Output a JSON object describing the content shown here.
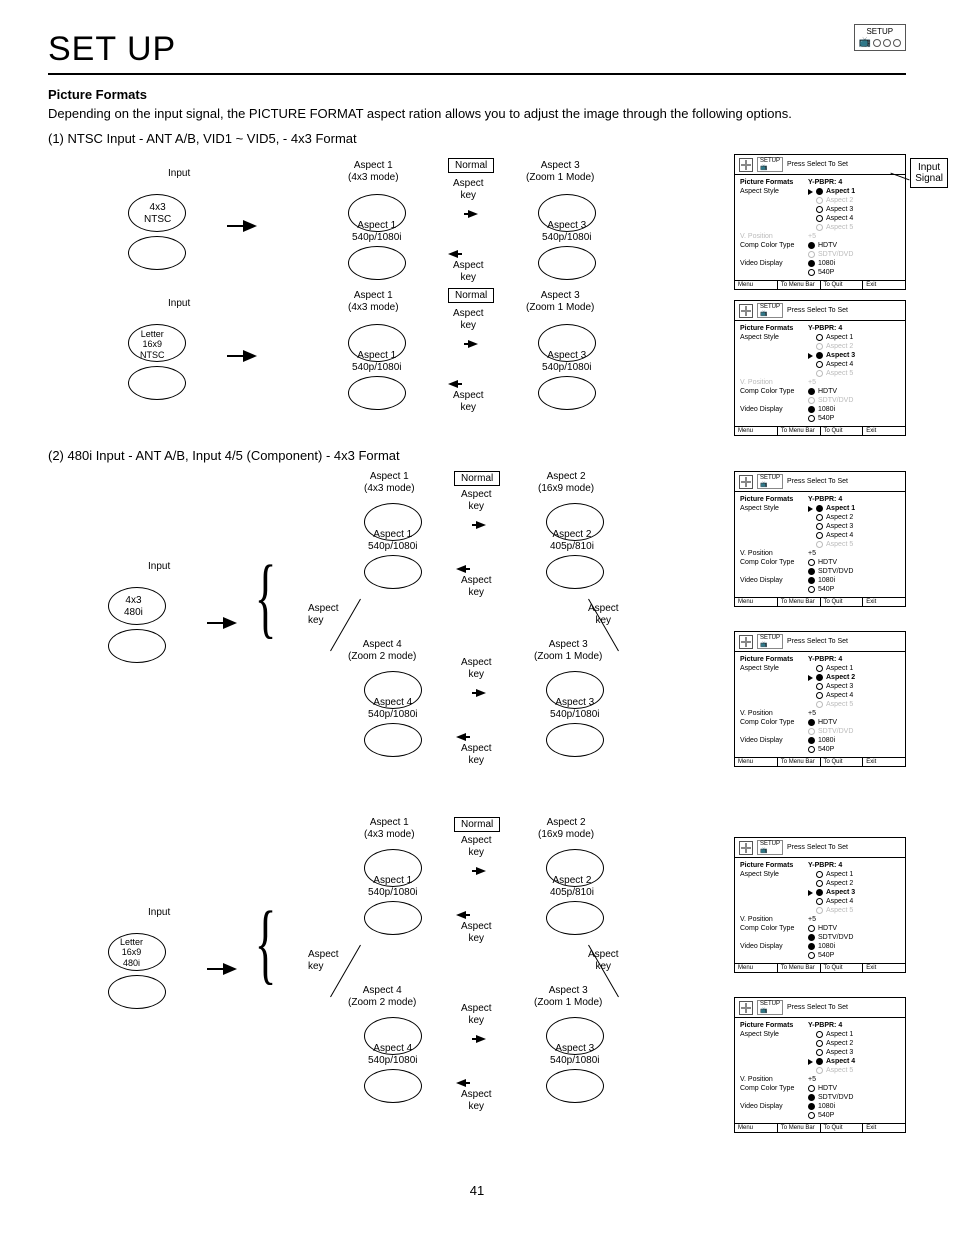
{
  "header": {
    "title": "SET UP",
    "icon_label": "SETUP"
  },
  "section1": {
    "heading": "Picture Formats",
    "desc": "Depending on the input signal, the PICTURE FORMAT aspect ration allows you to adjust the image through the following options.",
    "item1": "(1)  NTSC Input - ANT A/B, VID1 ~ VID5, - 4x3 Format"
  },
  "labels": {
    "input": "Input",
    "normal": "Normal",
    "aspect_key": "Aspect\nkey",
    "input_signal": "Input\nSignal",
    "ntsc43": "4x3\nNTSC",
    "letter169ntsc": "Letter\n16x9\nNTSC",
    "a1_4x3": "Aspect 1\n(4x3 mode)",
    "a1_540": "Aspect 1\n540p/1080i",
    "a3_zoom1": "Aspect 3\n(Zoom 1 Mode)",
    "a3_540": "Aspect 3\n540p/1080i",
    "a2_169": "Aspect 2\n(16x9 mode)",
    "a2_405": "Aspect 2\n405p/810i",
    "a4_zoom2": "Aspect 4\n(Zoom 2 mode)",
    "a4_540": "Aspect 4\n540p/1080i",
    "i480_43": "4x3\n480i",
    "i480_letter": "Letter\n16x9\n480i"
  },
  "section2": {
    "item2": "(2)  480i Input - ANT A/B, Input 4/5 (Component) - 4x3 Format"
  },
  "osd_common": {
    "press": "Press Select To Set",
    "pf": "Picture Formats",
    "yp": "Y-PBPR: 4",
    "as": "Aspect Style",
    "a1": "Aspect 1",
    "a2": "Aspect 2",
    "a3": "Aspect 3",
    "a4": "Aspect 4",
    "a5": "Aspect 5",
    "vpos": "V. Position",
    "plus5": "+5",
    "cct": "Comp Color Type",
    "hdtv": "HDTV",
    "sdtv": "SDTV/DVD",
    "vdisp": "Video Display",
    "v1080": "1080i",
    "v540": "540P",
    "menu": "Menu",
    "tomenubar": "To Menu Bar",
    "toquit": "To Quit",
    "exit": "Exit"
  },
  "osd_boxes": [
    {
      "aspect_sel": 1,
      "a2_grey": true,
      "a5_grey": true,
      "vpos_grey": true,
      "hdtv_sel": true,
      "sdtv_grey": true,
      "v1080_sel": true
    },
    {
      "aspect_sel": 3,
      "a2_grey": true,
      "a5_grey": true,
      "vpos_grey": true,
      "hdtv_sel": true,
      "sdtv_grey": true,
      "v1080_sel": true
    },
    {
      "aspect_sel": 1,
      "a5_grey": true,
      "hdtv_sel": false,
      "sdtv_sel": true,
      "v1080_sel": true
    },
    {
      "aspect_sel": 2,
      "a5_grey": true,
      "hdtv_sel": true,
      "sdtv_grey": true,
      "v1080_sel": true
    },
    {
      "aspect_sel": 3,
      "a5_grey": true,
      "hdtv_sel": false,
      "sdtv_sel": true,
      "v1080_sel": true
    },
    {
      "aspect_sel": 4,
      "a5_grey": true,
      "hdtv_sel": false,
      "sdtv_sel": true,
      "v1080_sel": true
    }
  ],
  "page_number": "41"
}
